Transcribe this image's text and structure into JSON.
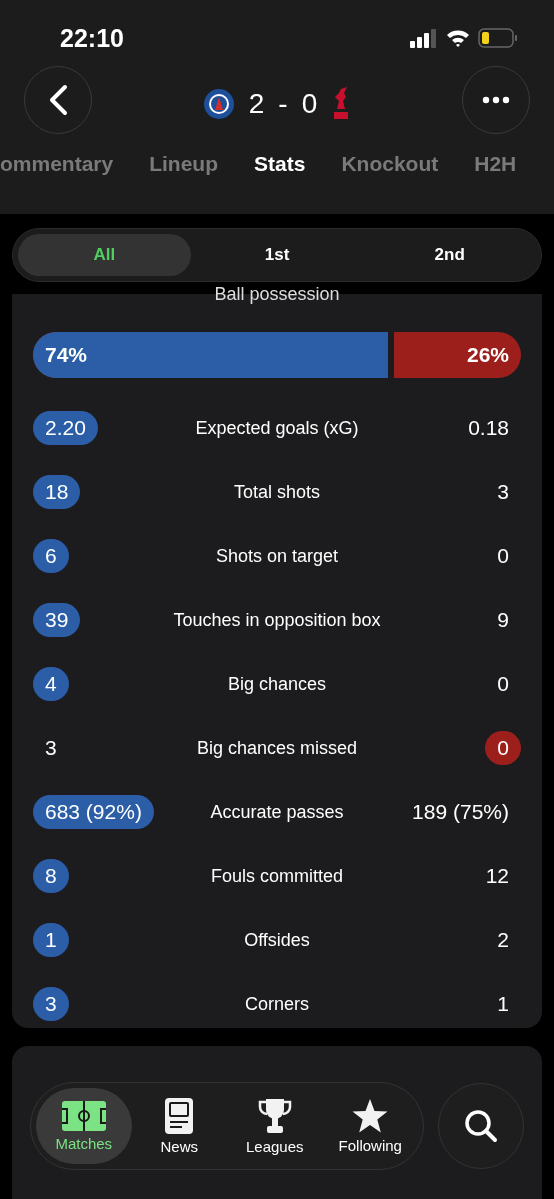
{
  "status_bar": {
    "time": "22:10"
  },
  "match": {
    "home_score": "2",
    "separator": "-",
    "away_score": "0"
  },
  "tabs": [
    {
      "label": "ommentary",
      "selected": false
    },
    {
      "label": "Lineup",
      "selected": false
    },
    {
      "label": "Stats",
      "selected": true
    },
    {
      "label": "Knockout",
      "selected": false
    },
    {
      "label": "H2H",
      "selected": false
    }
  ],
  "periods": [
    {
      "label": "All",
      "selected": true
    },
    {
      "label": "1st",
      "selected": false
    },
    {
      "label": "2nd",
      "selected": false
    }
  ],
  "possession": {
    "title": "Ball possession",
    "home": "74%",
    "away": "26%",
    "level": 0.74
  },
  "stats": [
    {
      "home": "2.20",
      "label": "Expected goals (xG)",
      "away": "0.18",
      "home_highlighted": true,
      "away_highlighted": false
    },
    {
      "home": "18",
      "label": "Total shots",
      "away": "3",
      "home_highlighted": true,
      "away_highlighted": false
    },
    {
      "home": "6",
      "label": "Shots on target",
      "away": "0",
      "home_highlighted": true,
      "away_highlighted": false
    },
    {
      "home": "39",
      "label": "Touches in opposition box",
      "away": "9",
      "home_highlighted": true,
      "away_highlighted": false
    },
    {
      "home": "4",
      "label": "Big chances",
      "away": "0",
      "home_highlighted": true,
      "away_highlighted": false
    },
    {
      "home": "3",
      "label": "Big chances missed",
      "away": "0",
      "home_highlighted": false,
      "away_highlighted": true
    },
    {
      "home": "683 (92%)",
      "label": "Accurate passes",
      "away": "189 (75%)",
      "home_highlighted": true,
      "away_highlighted": false
    },
    {
      "home": "8",
      "label": "Fouls committed",
      "away": "12",
      "home_highlighted": true,
      "away_highlighted": false
    },
    {
      "home": "1",
      "label": "Offsides",
      "away": "2",
      "home_highlighted": true,
      "away_highlighted": false
    },
    {
      "home": "3",
      "label": "Corners",
      "away": "1",
      "home_highlighted": true,
      "away_highlighted": false
    }
  ],
  "nav": [
    {
      "label": "Matches",
      "kind": "pitch",
      "selected": true
    },
    {
      "label": "News",
      "kind": "news",
      "selected": false
    },
    {
      "label": "Leagues",
      "kind": "trophy",
      "selected": false
    },
    {
      "label": "Following",
      "kind": "star",
      "selected": false
    }
  ]
}
